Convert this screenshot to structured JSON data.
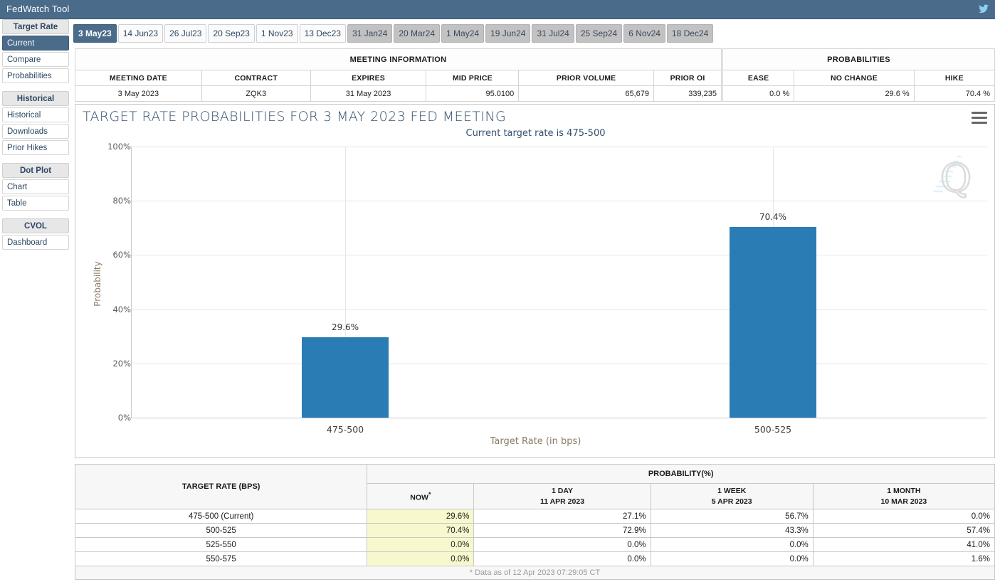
{
  "window": {
    "title": "FedWatch Tool",
    "corner_icon": "bird-icon"
  },
  "sidebar": {
    "groups": [
      {
        "heading": "Target Rate",
        "items": [
          {
            "label": "Current",
            "active": true
          },
          {
            "label": "Compare",
            "active": false
          },
          {
            "label": "Probabilities",
            "active": false
          }
        ]
      },
      {
        "heading": "Historical",
        "items": [
          {
            "label": "Historical",
            "active": false
          },
          {
            "label": "Downloads",
            "active": false
          },
          {
            "label": "Prior Hikes",
            "active": false
          }
        ]
      },
      {
        "heading": "Dot Plot",
        "items": [
          {
            "label": "Chart",
            "active": false
          },
          {
            "label": "Table",
            "active": false
          }
        ]
      },
      {
        "heading": "CVOL",
        "items": [
          {
            "label": "Dashboard",
            "active": false
          }
        ]
      }
    ]
  },
  "tabs": [
    {
      "label": "3 May23",
      "state": "active"
    },
    {
      "label": "14 Jun23",
      "state": "normal"
    },
    {
      "label": "26 Jul23",
      "state": "normal"
    },
    {
      "label": "20 Sep23",
      "state": "normal"
    },
    {
      "label": "1 Nov23",
      "state": "normal"
    },
    {
      "label": "13 Dec23",
      "state": "normal"
    },
    {
      "label": "31 Jan24",
      "state": "dim"
    },
    {
      "label": "20 Mar24",
      "state": "dim"
    },
    {
      "label": "1 May24",
      "state": "dim"
    },
    {
      "label": "19 Jun24",
      "state": "dim"
    },
    {
      "label": "31 Jul24",
      "state": "dim"
    },
    {
      "label": "25 Sep24",
      "state": "dim"
    },
    {
      "label": "6 Nov24",
      "state": "dim"
    },
    {
      "label": "18 Dec24",
      "state": "dim"
    }
  ],
  "meeting_information": {
    "heading": "MEETING INFORMATION",
    "columns": [
      "MEETING DATE",
      "CONTRACT",
      "EXPIRES",
      "MID PRICE",
      "PRIOR VOLUME",
      "PRIOR OI"
    ],
    "row": {
      "meeting_date": "3 May 2023",
      "contract": "ZQK3",
      "expires": "31 May 2023",
      "mid_price": "95.0100",
      "prior_volume": "65,679",
      "prior_oi": "339,235"
    }
  },
  "probabilities_summary": {
    "heading": "PROBABILITIES",
    "columns": [
      "EASE",
      "NO CHANGE",
      "HIKE"
    ],
    "row": {
      "ease": "0.0 %",
      "no_change": "29.6 %",
      "hike": "70.4 %"
    }
  },
  "chart_panel": {
    "title": "TARGET RATE PROBABILITIES FOR 3 MAY 2023 FED MEETING",
    "subtitle": "Current target rate is 475-500",
    "menu_icon": "hamburger-menu-icon",
    "watermark_icon": "q-logo-watermark-icon"
  },
  "chart_data": {
    "type": "bar",
    "title": "TARGET RATE PROBABILITIES FOR 3 MAY 2023 FED MEETING",
    "subtitle": "Current target rate is 475-500",
    "categories": [
      "475-500",
      "500-525"
    ],
    "values": [
      29.6,
      70.4
    ],
    "value_labels": [
      "29.6%",
      "70.4%"
    ],
    "xlabel": "Target Rate (in bps)",
    "ylabel": "Probability",
    "ylim": [
      0,
      100
    ],
    "yticks": [
      0,
      20,
      40,
      60,
      80,
      100
    ],
    "ytick_labels": [
      "0%",
      "20%",
      "40%",
      "60%",
      "80%",
      "100%"
    ],
    "grid": true,
    "legend": "none",
    "bar_color": "#2a7cb5"
  },
  "probability_table": {
    "rate_header": "TARGET RATE (BPS)",
    "span_header": "PROBABILITY(%)",
    "columns": [
      {
        "line1": "NOW",
        "line2": "",
        "star": true
      },
      {
        "line1": "1 DAY",
        "line2": "11 APR 2023",
        "star": false
      },
      {
        "line1": "1 WEEK",
        "line2": "5 APR 2023",
        "star": false
      },
      {
        "line1": "1 MONTH",
        "line2": "10 MAR 2023",
        "star": false
      }
    ],
    "rows": [
      {
        "rate": "475-500 (Current)",
        "now": "29.6%",
        "day": "27.1%",
        "week": "56.7%",
        "month": "0.0%"
      },
      {
        "rate": "500-525",
        "now": "70.4%",
        "day": "72.9%",
        "week": "43.3%",
        "month": "57.4%"
      },
      {
        "rate": "525-550",
        "now": "0.0%",
        "day": "0.0%",
        "week": "0.0%",
        "month": "41.0%"
      },
      {
        "rate": "550-575",
        "now": "0.0%",
        "day": "0.0%",
        "week": "0.0%",
        "month": "1.6%"
      }
    ],
    "footnote": "* Data as of 12 Apr 2023 07:29:05 CT"
  }
}
